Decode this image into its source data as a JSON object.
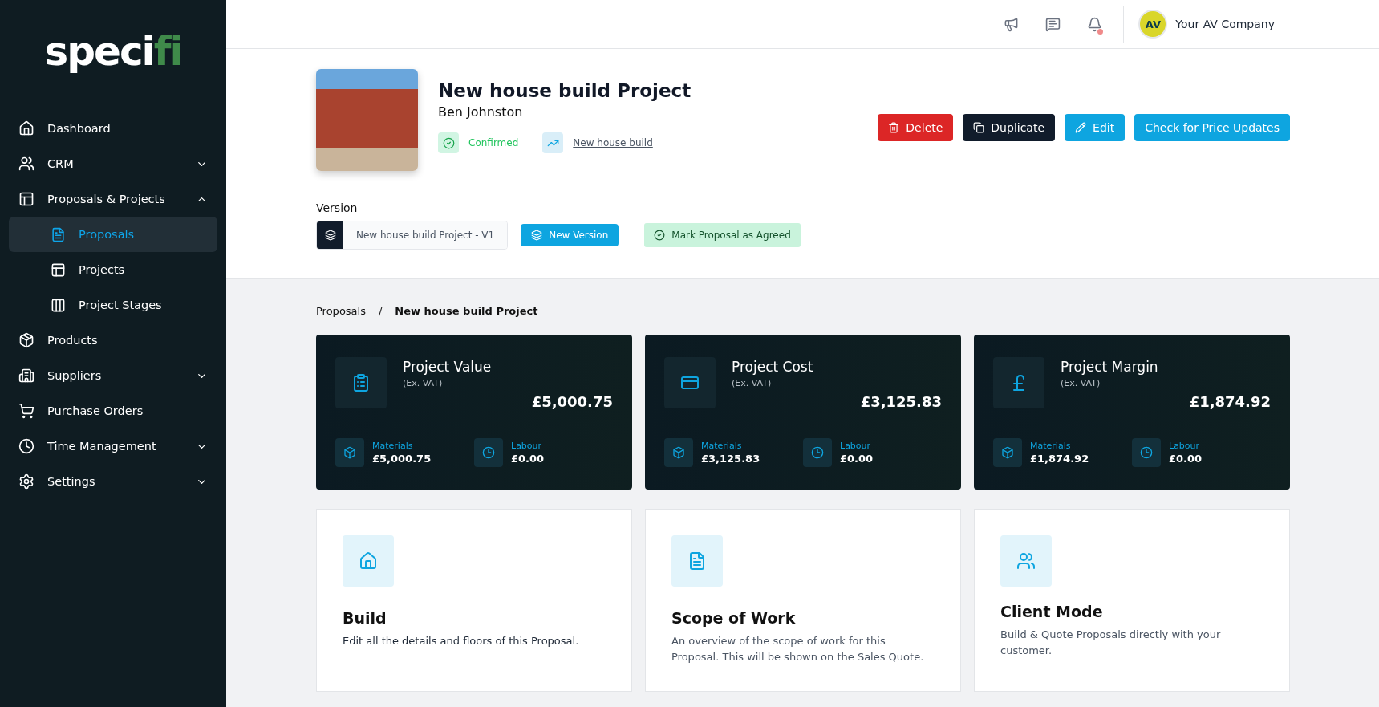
{
  "logo": {
    "main": "spec",
    "dot_letter": "i",
    "accent": "fi"
  },
  "sidebar": {
    "items": [
      {
        "label": "Dashboard"
      },
      {
        "label": "CRM",
        "expanded": false
      },
      {
        "label": "Proposals & Projects",
        "expanded": true,
        "children": [
          {
            "label": "Proposals",
            "selected": true
          },
          {
            "label": "Projects",
            "selected": false
          },
          {
            "label": "Project Stages",
            "selected": false
          }
        ]
      },
      {
        "label": "Products"
      },
      {
        "label": "Suppliers",
        "expanded": false
      },
      {
        "label": "Purchase Orders"
      },
      {
        "label": "Time Management",
        "expanded": false
      },
      {
        "label": "Settings",
        "expanded": false
      }
    ]
  },
  "topbar": {
    "notifications_unread": true,
    "avatar_initials": "AV",
    "company": "Your AV Company"
  },
  "project": {
    "title": "New house build Project",
    "client": "Ben Johnston",
    "status": "Confirmed",
    "link": "New house build",
    "actions": [
      {
        "label": "Delete",
        "kind": "danger"
      },
      {
        "label": "Duplicate",
        "kind": "dark"
      },
      {
        "label": "Edit",
        "kind": "primary"
      },
      {
        "label": "Check for Price Updates",
        "kind": "primary"
      }
    ],
    "version_label": "Version",
    "version_value": "New house build Project - V1",
    "new_version": "New Version",
    "mark_agreed": "Mark Proposal as Agreed"
  },
  "breadcrumb": {
    "parent": "Proposals",
    "separator": "/",
    "current": "New house build Project"
  },
  "stats": [
    {
      "title": "Project Value",
      "note": "(Ex. VAT)",
      "total": "£5,000.75",
      "materials_label": "Materials",
      "materials": "£5,000.75",
      "labour_label": "Labour",
      "labour": "£0.00"
    },
    {
      "title": "Project Cost",
      "note": "(Ex. VAT)",
      "total": "£3,125.83",
      "materials_label": "Materials",
      "materials": "£3,125.83",
      "labour_label": "Labour",
      "labour": "£0.00"
    },
    {
      "title": "Project Margin",
      "note": "(Ex. VAT)",
      "total": "£1,874.92",
      "materials_label": "Materials",
      "materials": "£1,874.92",
      "labour_label": "Labour",
      "labour": "£0.00"
    }
  ],
  "cards": [
    {
      "title": "Build",
      "description": "Edit all the details and floors of this Proposal."
    },
    {
      "title": "Scope of Work",
      "description": "An overview of the scope of work for this Proposal. This will be shown on the Sales Quote."
    },
    {
      "title": "Client Mode",
      "description": "Build & Quote Proposals directly with your customer."
    }
  ]
}
